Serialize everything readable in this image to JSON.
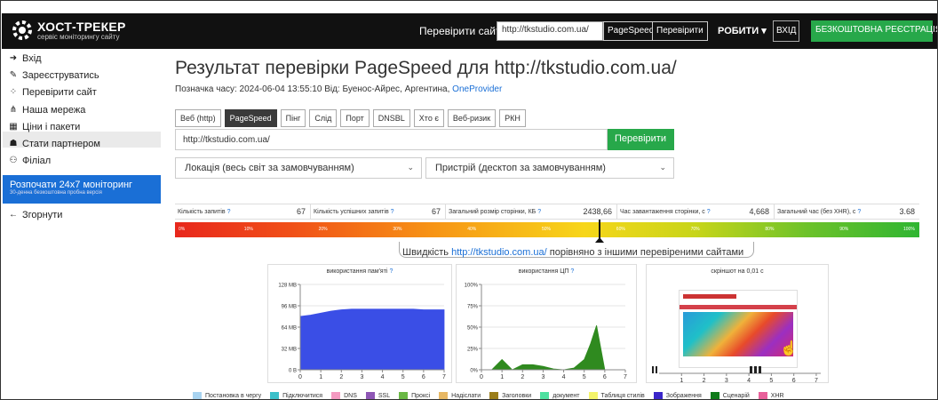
{
  "header": {
    "logo_title": "ХОСТ-ТРЕКЕР",
    "logo_sub": "сервіс моніторингу сайту",
    "check_label": "Перевірити сайт",
    "check_value": "http://tkstudio.com.ua/",
    "pagespeed_btn": "PageSpeed",
    "check_btn": "Перевірити",
    "menu_label": "РОБИТИ",
    "login": "ВХІД",
    "register": "БЕЗКОШТОВНА РЕЄСТРАЦІЯ"
  },
  "sidebar": {
    "items": [
      {
        "label": "Вхід",
        "icon": "login-icon",
        "glyph": "➜"
      },
      {
        "label": "Зареєструватись",
        "icon": "edit-icon",
        "glyph": "✎"
      },
      {
        "label": "Перевірити сайт",
        "icon": "spinner-icon",
        "glyph": "⁘"
      },
      {
        "label": "Наша мережа",
        "icon": "network-icon",
        "glyph": "⋔"
      },
      {
        "label": "Ціни і пакети",
        "icon": "grid-icon",
        "glyph": "▦"
      },
      {
        "label": "Стати партнером",
        "icon": "users-icon",
        "glyph": "☗"
      },
      {
        "label": "Філіал",
        "icon": "handshake-icon",
        "glyph": "⚇"
      }
    ],
    "promo_title": "Розпочати 24х7 моніторинг",
    "promo_sub": "30-денна безкоштовна пробна версія",
    "collapse": "Згорнути"
  },
  "main": {
    "title": "Результат перевірки PageSpeed для http://tkstudio.com.ua/",
    "timestamp_prefix": "Позначка часу: 2024-06-04 13:55:10  Від: Буенос-Айрес, Аргентина,",
    "provider": "OneProvider",
    "tabs": [
      "Веб (http)",
      "PageSpeed",
      "Пінг",
      "Слід",
      "Порт",
      "DNSBL",
      "Хто є",
      "Веб-ризик",
      "РКН"
    ],
    "active_tab": "PageSpeed",
    "url_value": "http://tkstudio.com.ua/",
    "submit": "Перевірити",
    "location_select": "Локація (весь світ за замовчуванням)",
    "device_select": "Пристрій (десктоп за замовчуванням)"
  },
  "stats": [
    {
      "label": "Кількість запитів",
      "value": "67"
    },
    {
      "label": "Кількість успішних запитів",
      "value": "67"
    },
    {
      "label": "Загальний розмір сторінки, КБ",
      "value": "2438,66"
    },
    {
      "label": "Час завантаження сторінки, с",
      "value": "4,668"
    },
    {
      "label": "Загальний час (без XHR), с",
      "value": "3.68"
    }
  ],
  "scale_ticks": [
    "0%",
    "10%",
    "20%",
    "30%",
    "40%",
    "50%",
    "60%",
    "70%",
    "80%",
    "90%",
    "100%"
  ],
  "speed_percentile": 57,
  "compare": {
    "prefix": "Швидкість",
    "url": "http://tkstudio.com.ua/",
    "suffix": "порівняно з іншими перевіреними сайтами"
  },
  "chart_data": [
    {
      "type": "area",
      "title": "використання пам'яті",
      "x": [
        0,
        0.5,
        1,
        1.5,
        2,
        2.5,
        3,
        3.5,
        4,
        4.5,
        5,
        5.5,
        6,
        6.5,
        7
      ],
      "values": [
        80,
        82,
        85,
        88,
        90,
        91,
        91,
        91,
        91,
        91,
        91,
        91,
        90,
        90,
        90
      ],
      "yticks": [
        "0 B",
        "32 MB",
        "64 MB",
        "96 MB",
        "128 MB"
      ],
      "ylim": [
        0,
        128
      ],
      "xticks": [
        "0",
        "1",
        "2",
        "3",
        "4",
        "5",
        "6",
        "7"
      ],
      "color": "#3a4ee6"
    },
    {
      "type": "area",
      "title": "використання ЦП",
      "x": [
        0,
        0.5,
        1,
        1.5,
        2,
        2.5,
        3,
        3.5,
        4,
        4.5,
        5,
        5.3,
        5.6,
        6,
        6.5,
        7
      ],
      "values": [
        0,
        0,
        12,
        0,
        6,
        6,
        4,
        1,
        0,
        2,
        12,
        30,
        52,
        0,
        0,
        0
      ],
      "yticks": [
        "0%",
        "25%",
        "50%",
        "75%",
        "100%"
      ],
      "ylim": [
        0,
        100
      ],
      "xticks": [
        "0",
        "1",
        "2",
        "3",
        "4",
        "5",
        "6",
        "7"
      ],
      "color": "#2f8a1f"
    }
  ],
  "screenshot_title": "скріншот на 0,01 с",
  "screenshot_xticks": [
    "1",
    "2",
    "3",
    "4",
    "5",
    "6",
    "7"
  ],
  "legend": [
    {
      "label": "Постановка в чергу",
      "color": "#a8d3f0"
    },
    {
      "label": "Підключитися",
      "color": "#3cc0c9"
    },
    {
      "label": "DNS",
      "color": "#f49ac1"
    },
    {
      "label": "SSL",
      "color": "#8e56b5"
    },
    {
      "label": "Проксі",
      "color": "#6ab845"
    },
    {
      "label": "Надіслати",
      "color": "#e8b864"
    },
    {
      "label": "Заголовки",
      "color": "#9a7d1a"
    },
    {
      "label": "документ",
      "color": "#4ee0a0"
    },
    {
      "label": "Таблиця стилів",
      "color": "#f4f46a"
    },
    {
      "label": "Зображення",
      "color": "#3a26c9"
    },
    {
      "label": "Сценарій",
      "color": "#0f7a1a"
    },
    {
      "label": "XHR",
      "color": "#e8609a"
    }
  ]
}
